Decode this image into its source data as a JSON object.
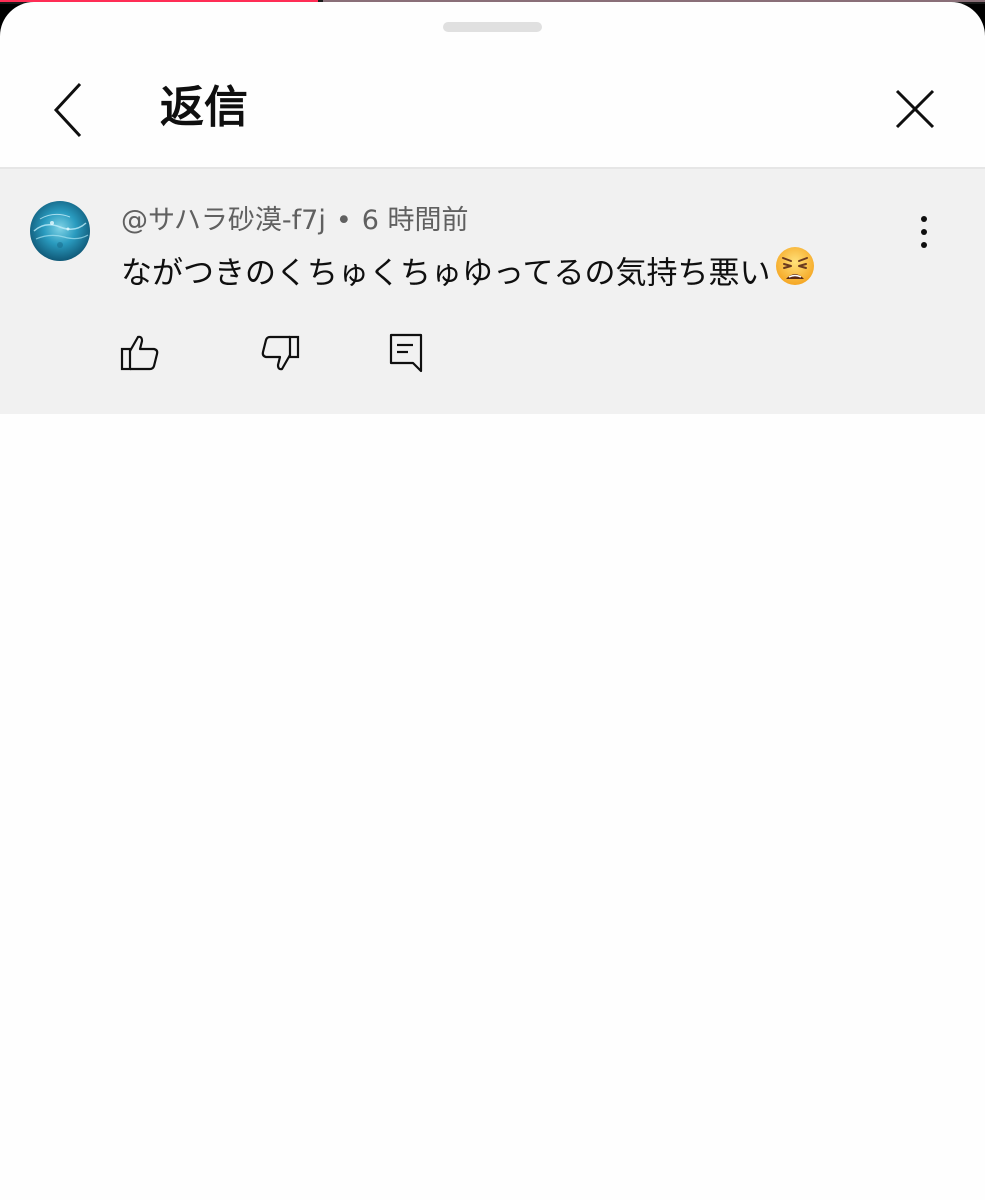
{
  "playback": {
    "progress_percent": 32.3,
    "accent_color": "#ff2d55"
  },
  "sheet": {
    "title": "返信",
    "back_icon": "chevron-left-icon",
    "close_icon": "close-icon"
  },
  "comment": {
    "author": "@サハラ砂漠-f7j",
    "separator": "•",
    "time": "6 時間前",
    "text": "ながつきのくちゅくちゅゆってるの気持ち悪い",
    "emoji": "weary-face-emoji",
    "actions": {
      "like_icon": "thumbs-up-icon",
      "dislike_icon": "thumbs-down-icon",
      "reply_icon": "reply-comment-icon",
      "more_icon": "more-vertical-icon"
    }
  }
}
